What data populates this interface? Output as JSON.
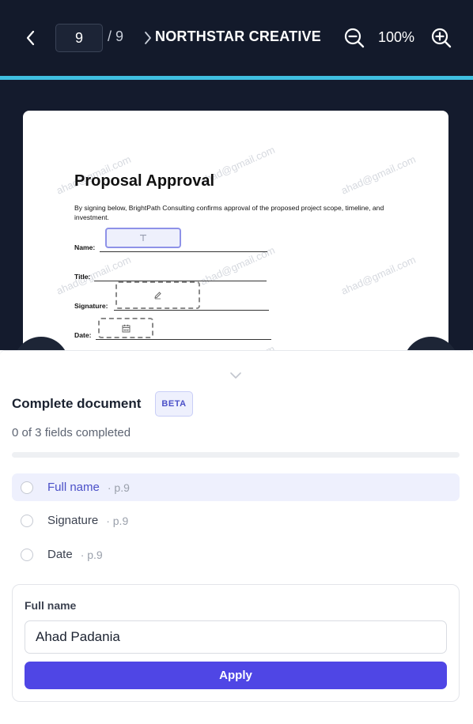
{
  "toolbar": {
    "current_page": "9",
    "page_total": "/ 9",
    "document_title": "NORTHSTAR CREATIVE",
    "zoom_level": "100%",
    "accent_color": "#3fbfe0"
  },
  "pdf_page": {
    "watermark": "ahad@gmail.com",
    "title": "Proposal Approval",
    "body": "By signing below, BrightPath Consulting confirms approval of the proposed project scope, timeline, and investment.",
    "labels": {
      "name": "Name:",
      "title": "Title:",
      "signature": "Signature:",
      "date": "Date:"
    },
    "text_field_icon": "text-icon",
    "signature_field_icon": "pen-icon",
    "date_field_icon": "calendar-icon"
  },
  "panel": {
    "title": "Complete document",
    "badge": "BETA",
    "progress_text": "0 of 3 fields completed",
    "progress_fraction": 0,
    "fields": [
      {
        "name": "Full name",
        "page": "· p.9",
        "active": true
      },
      {
        "name": "Signature",
        "page": "· p.9",
        "active": false
      },
      {
        "name": "Date",
        "page": "· p.9",
        "active": false
      }
    ],
    "form": {
      "label": "Full name",
      "value": "Ahad Padania",
      "apply_label": "Apply"
    },
    "accent_color": "#4f46e5"
  }
}
